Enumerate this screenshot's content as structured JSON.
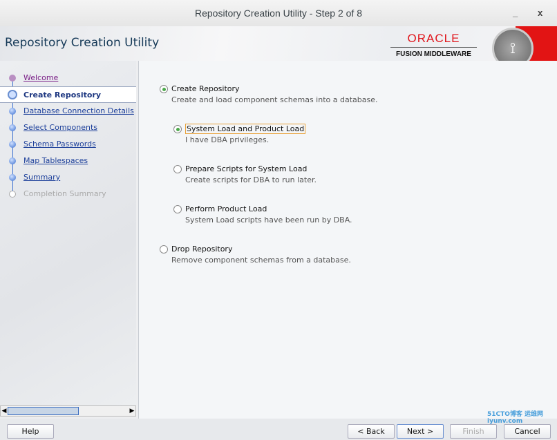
{
  "window": {
    "title": "Repository Creation Utility - Step 2 of 8",
    "minimize": "_",
    "close": "x"
  },
  "banner": {
    "title": "Repository Creation Utility",
    "logo_top": "ORACLE",
    "logo_bottom": "FUSION MIDDLEWARE"
  },
  "steps": [
    {
      "label": "Welcome",
      "state": "visited"
    },
    {
      "label": "Create Repository",
      "state": "current"
    },
    {
      "label": "Database Connection Details",
      "state": "pending"
    },
    {
      "label": "Select Components",
      "state": "pending"
    },
    {
      "label": "Schema Passwords",
      "state": "pending"
    },
    {
      "label": "Map Tablespaces",
      "state": "pending"
    },
    {
      "label": "Summary",
      "state": "pending"
    },
    {
      "label": "Completion Summary",
      "state": "disabled"
    }
  ],
  "options": {
    "create": {
      "label": "Create Repository",
      "desc": "Create and load component schemas into a database.",
      "selected": true
    },
    "system_product": {
      "label": "System Load and Product Load",
      "desc": "I have DBA privileges.",
      "selected": true
    },
    "prepare": {
      "label": "Prepare Scripts for System Load",
      "desc": "Create scripts for DBA to run later.",
      "selected": false
    },
    "product": {
      "label": "Perform Product Load",
      "desc": "System Load scripts have been run by DBA.",
      "selected": false
    },
    "drop": {
      "label": "Drop Repository",
      "desc": "Remove component schemas from a database.",
      "selected": false
    }
  },
  "buttons": {
    "help": "Help",
    "back": "< Back",
    "next": "Next >",
    "finish": "Finish",
    "cancel": "Cancel"
  },
  "watermark": "51CTO博客 运维网 iyunv.com"
}
